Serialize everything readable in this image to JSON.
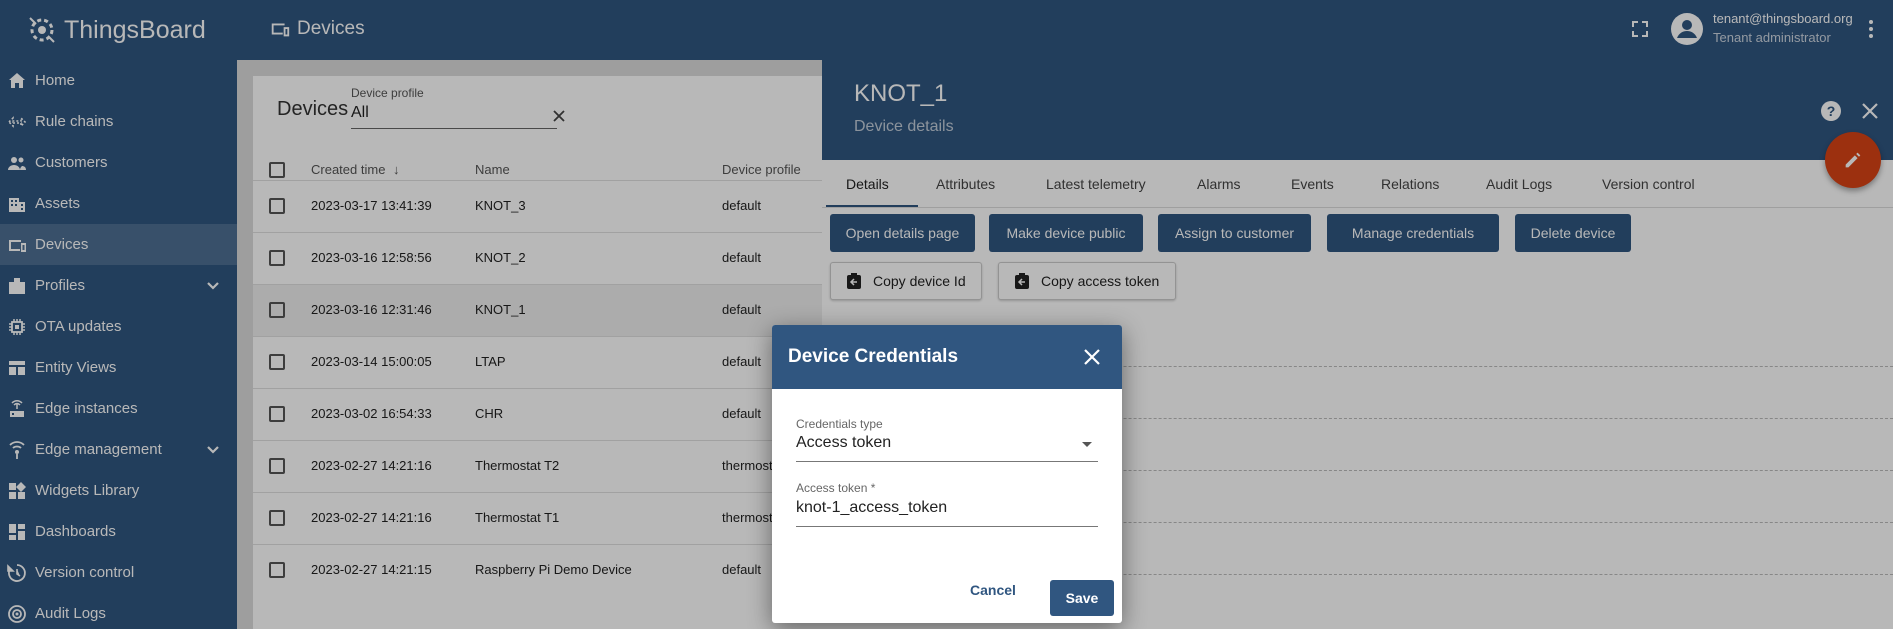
{
  "app": {
    "name": "ThingsBoard"
  },
  "sidebar": {
    "items": [
      {
        "label": "Home",
        "icon": "home-icon"
      },
      {
        "label": "Rule chains",
        "icon": "rule-chain-icon"
      },
      {
        "label": "Customers",
        "icon": "customers-icon"
      },
      {
        "label": "Assets",
        "icon": "assets-icon"
      },
      {
        "label": "Devices",
        "icon": "devices-icon",
        "active": true
      },
      {
        "label": "Profiles",
        "icon": "profiles-icon",
        "expandable": true
      },
      {
        "label": "OTA updates",
        "icon": "ota-icon"
      },
      {
        "label": "Entity Views",
        "icon": "entity-views-icon"
      },
      {
        "label": "Edge instances",
        "icon": "edge-icon"
      },
      {
        "label": "Edge management",
        "icon": "edge-management-icon",
        "expandable": true
      },
      {
        "label": "Widgets Library",
        "icon": "widgets-icon"
      },
      {
        "label": "Dashboards",
        "icon": "dashboards-icon"
      },
      {
        "label": "Version control",
        "icon": "version-control-icon"
      },
      {
        "label": "Audit Logs",
        "icon": "audit-logs-icon"
      }
    ]
  },
  "topbar": {
    "title": "Devices",
    "user_email": "tenant@thingsboard.org",
    "user_role": "Tenant administrator"
  },
  "devices_table": {
    "title": "Devices",
    "filter": {
      "label": "Device profile",
      "value": "All"
    },
    "columns": [
      "Created time",
      "Name",
      "Device profile"
    ],
    "rows": [
      {
        "created": "2023-03-17 13:41:39",
        "name": "KNOT_3",
        "profile": "default"
      },
      {
        "created": "2023-03-16 12:58:56",
        "name": "KNOT_2",
        "profile": "default"
      },
      {
        "created": "2023-03-16 12:31:46",
        "name": "KNOT_1",
        "profile": "default",
        "selected": true
      },
      {
        "created": "2023-03-14 15:00:05",
        "name": "LTAP",
        "profile": "default"
      },
      {
        "created": "2023-03-02 16:54:33",
        "name": "CHR",
        "profile": "default"
      },
      {
        "created": "2023-02-27 14:21:16",
        "name": "Thermostat T2",
        "profile": "thermosta"
      },
      {
        "created": "2023-02-27 14:21:16",
        "name": "Thermostat T1",
        "profile": "thermosta"
      },
      {
        "created": "2023-02-27 14:21:15",
        "name": "Raspberry Pi Demo Device",
        "profile": "default"
      }
    ]
  },
  "detail": {
    "title": "KNOT_1",
    "subtitle": "Device details",
    "tabs": [
      "Details",
      "Attributes",
      "Latest telemetry",
      "Alarms",
      "Events",
      "Relations",
      "Audit Logs",
      "Version control"
    ],
    "actions": [
      "Open details page",
      "Make device public",
      "Assign to customer",
      "Manage credentials",
      "Delete device"
    ],
    "copy_actions": [
      "Copy device Id",
      "Copy access token"
    ]
  },
  "dialog": {
    "title": "Device Credentials",
    "credentials_type_label": "Credentials type",
    "credentials_type_value": "Access token",
    "access_token_label": "Access token *",
    "access_token_value": "knot-1_access_token",
    "cancel_label": "Cancel",
    "save_label": "Save"
  },
  "colors": {
    "primary": "#305680",
    "accent": "#d84315"
  }
}
